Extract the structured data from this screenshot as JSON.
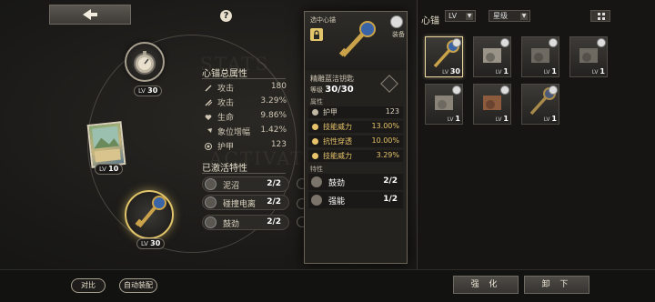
{
  "help_glyph": "?",
  "slots": {
    "top": {
      "lv_prefix": "LV",
      "lv": "30"
    },
    "middle": {
      "lv_prefix": "LV",
      "lv": "10"
    },
    "bottom": {
      "lv_prefix": "LV",
      "lv": "30"
    }
  },
  "total_attributes": {
    "title": "心锚总属性",
    "rows": [
      {
        "name": "攻击",
        "value": "180",
        "icon": "sword-icon"
      },
      {
        "name": "攻击",
        "value": "3.29%",
        "icon": "sword-icon"
      },
      {
        "name": "生命",
        "value": "9.86%",
        "icon": "heart-icon"
      },
      {
        "name": "象位增幅",
        "value": "1.42%",
        "icon": "arrow-icon"
      },
      {
        "name": "护甲",
        "value": "123",
        "icon": "shield-icon"
      }
    ]
  },
  "activated_traits": {
    "title": "已激活特性",
    "rows": [
      {
        "name": "泥沼",
        "count": "2/2"
      },
      {
        "name": "碰撞电离",
        "count": "2/2"
      },
      {
        "name": "鼓劲",
        "count": "2/2"
      }
    ]
  },
  "tooltip": {
    "selected_label": "选中心锚",
    "equip_label": "装备",
    "name": "精雕蓝洁钥匙",
    "level_prefix": "等级",
    "level": "30/30",
    "attr_section": "属性",
    "attrs": [
      {
        "name": "护甲",
        "value": "123",
        "highlight": false
      },
      {
        "name": "技能威力",
        "value": "13.00%",
        "highlight": true
      },
      {
        "name": "抗性穿透",
        "value": "10.00%",
        "highlight": true
      },
      {
        "name": "技能威力",
        "value": "3.29%",
        "highlight": true
      }
    ],
    "trait_section": "特性",
    "traits": [
      {
        "name": "鼓劲",
        "count": "2/2"
      },
      {
        "name": "强能",
        "count": "1/2"
      }
    ]
  },
  "inventory": {
    "title": "心锚",
    "filter_lv": "LV",
    "filter_star": "星级",
    "items": [
      {
        "lv_prefix": "LV",
        "lv": "30",
        "selected": true
      },
      {
        "lv_prefix": "LV",
        "lv": "1",
        "selected": false
      },
      {
        "lv_prefix": "LV",
        "lv": "1",
        "selected": false
      },
      {
        "lv_prefix": "LV",
        "lv": "1",
        "selected": false
      },
      {
        "lv_prefix": "LV",
        "lv": "1",
        "selected": false
      },
      {
        "lv_prefix": "LV",
        "lv": "1",
        "selected": false
      },
      {
        "lv_prefix": "LV",
        "lv": "1",
        "selected": false
      }
    ]
  },
  "bottom": {
    "compare": "对比",
    "auto_equip": "自动装配",
    "enhance": "强 化",
    "unequip": "卸 下"
  },
  "colors": {
    "accent_gold": "#e2c46a",
    "highlight_gold": "#e6c26a"
  }
}
